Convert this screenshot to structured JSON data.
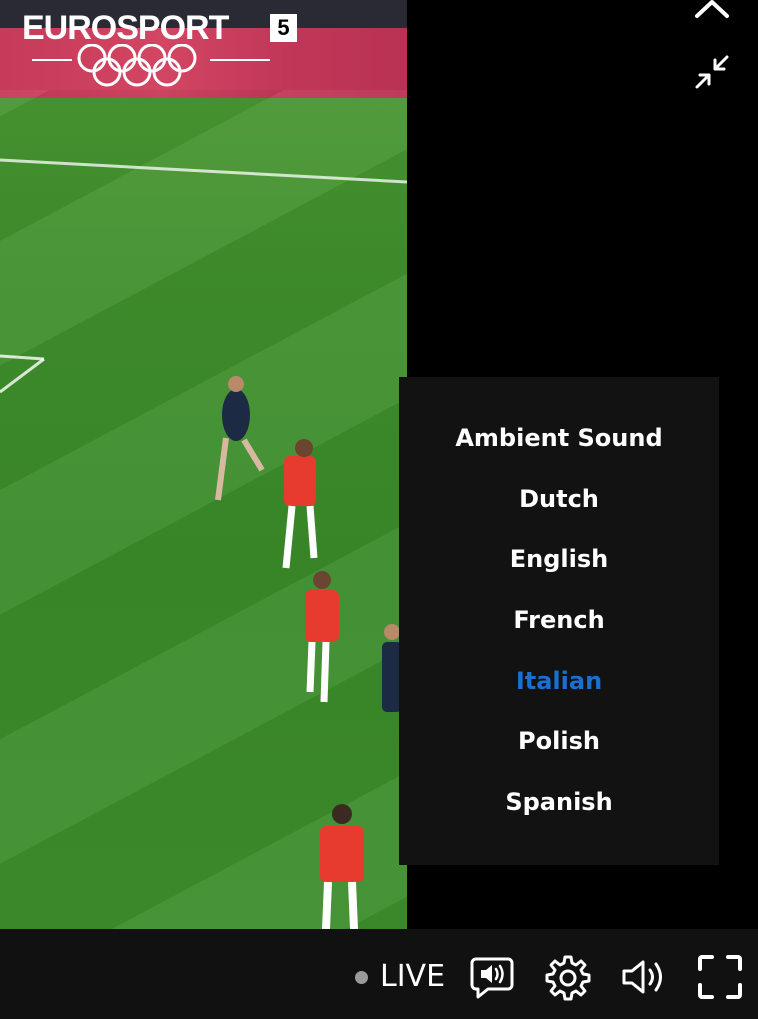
{
  "video": {
    "brand_name": "EUROSPORT",
    "channel_number": "5"
  },
  "icons": {
    "close": "close-icon",
    "minimize": "minimize-icon",
    "audio_description": "audio-description-icon",
    "settings": "gear-icon",
    "volume": "volume-icon",
    "fullscreen": "fullscreen-icon"
  },
  "audio_menu": {
    "items": [
      {
        "label": "Ambient Sound",
        "selected": false
      },
      {
        "label": "Dutch",
        "selected": false
      },
      {
        "label": "English",
        "selected": false
      },
      {
        "label": "French",
        "selected": false
      },
      {
        "label": "Italian",
        "selected": true
      },
      {
        "label": "Polish",
        "selected": false
      },
      {
        "label": "Spanish",
        "selected": false
      }
    ]
  },
  "control_bar": {
    "live_label": "LIVE"
  },
  "colors": {
    "background": "#000000",
    "menu_background": "#121212",
    "control_bar": "#111111",
    "selected_item": "#1a6fd1",
    "live_dot": "#9a9a9a"
  }
}
